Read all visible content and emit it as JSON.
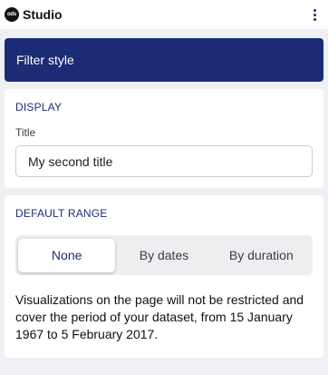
{
  "app": {
    "logo_text": "ods",
    "name": "Studio",
    "menu_icon": "more-vertical-icon"
  },
  "header": {
    "title": "Filter style"
  },
  "display": {
    "section_title": "DISPLAY",
    "title_label": "Title",
    "title_value": "My second title"
  },
  "range": {
    "section_title": "DEFAULT RANGE",
    "options": [
      "None",
      "By dates",
      "By duration"
    ],
    "selected": "None",
    "description": "Visualizations on the page will not be restricted and cover the period of your dataset, from 15 January 1967 to 5 February 2017."
  },
  "colors": {
    "brand_navy": "#1c2c74",
    "accent_text": "#1e2d78",
    "background": "#eef0f3"
  }
}
